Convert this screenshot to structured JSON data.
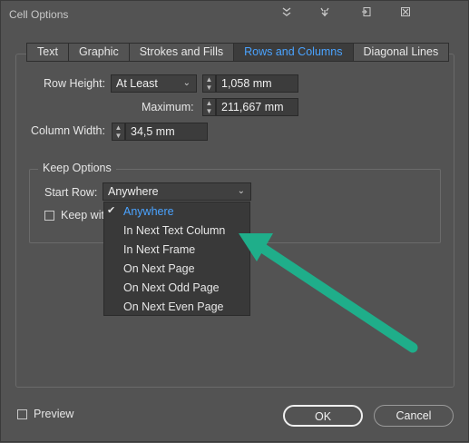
{
  "window": {
    "title": "Cell Options"
  },
  "titlebar_icons": [
    "collapse-icon",
    "spacing-icon",
    "import-icon",
    "close-grid-icon"
  ],
  "tabs": [
    {
      "label": "Text",
      "active": false
    },
    {
      "label": "Graphic",
      "active": false
    },
    {
      "label": "Strokes and Fills",
      "active": false
    },
    {
      "label": "Rows and Columns",
      "active": true
    },
    {
      "label": "Diagonal Lines",
      "active": false
    }
  ],
  "row_height": {
    "label": "Row Height:",
    "mode": "At Least",
    "value": "1,058 mm",
    "maximum_label": "Maximum:",
    "maximum_value": "211,667 mm"
  },
  "column_width": {
    "label": "Column Width:",
    "value": "34,5 mm"
  },
  "keep_options": {
    "title": "Keep Options",
    "start_row_label": "Start Row:",
    "start_row_value": "Anywhere",
    "keep_with_label": "Keep wit"
  },
  "dropdown": {
    "items": [
      {
        "label": "Anywhere",
        "selected": true
      },
      {
        "label": "In Next Text Column",
        "selected": false
      },
      {
        "label": "In Next Frame",
        "selected": false
      },
      {
        "label": "On Next Page",
        "selected": false
      },
      {
        "label": "On Next Odd Page",
        "selected": false
      },
      {
        "label": "On Next Even Page",
        "selected": false
      }
    ]
  },
  "preview": {
    "label": "Preview",
    "checked": false
  },
  "buttons": {
    "ok": "OK",
    "cancel": "Cancel"
  },
  "colors": {
    "accent": "#4aa3ff",
    "arrow": "#1fae8a",
    "background": "#535353"
  }
}
